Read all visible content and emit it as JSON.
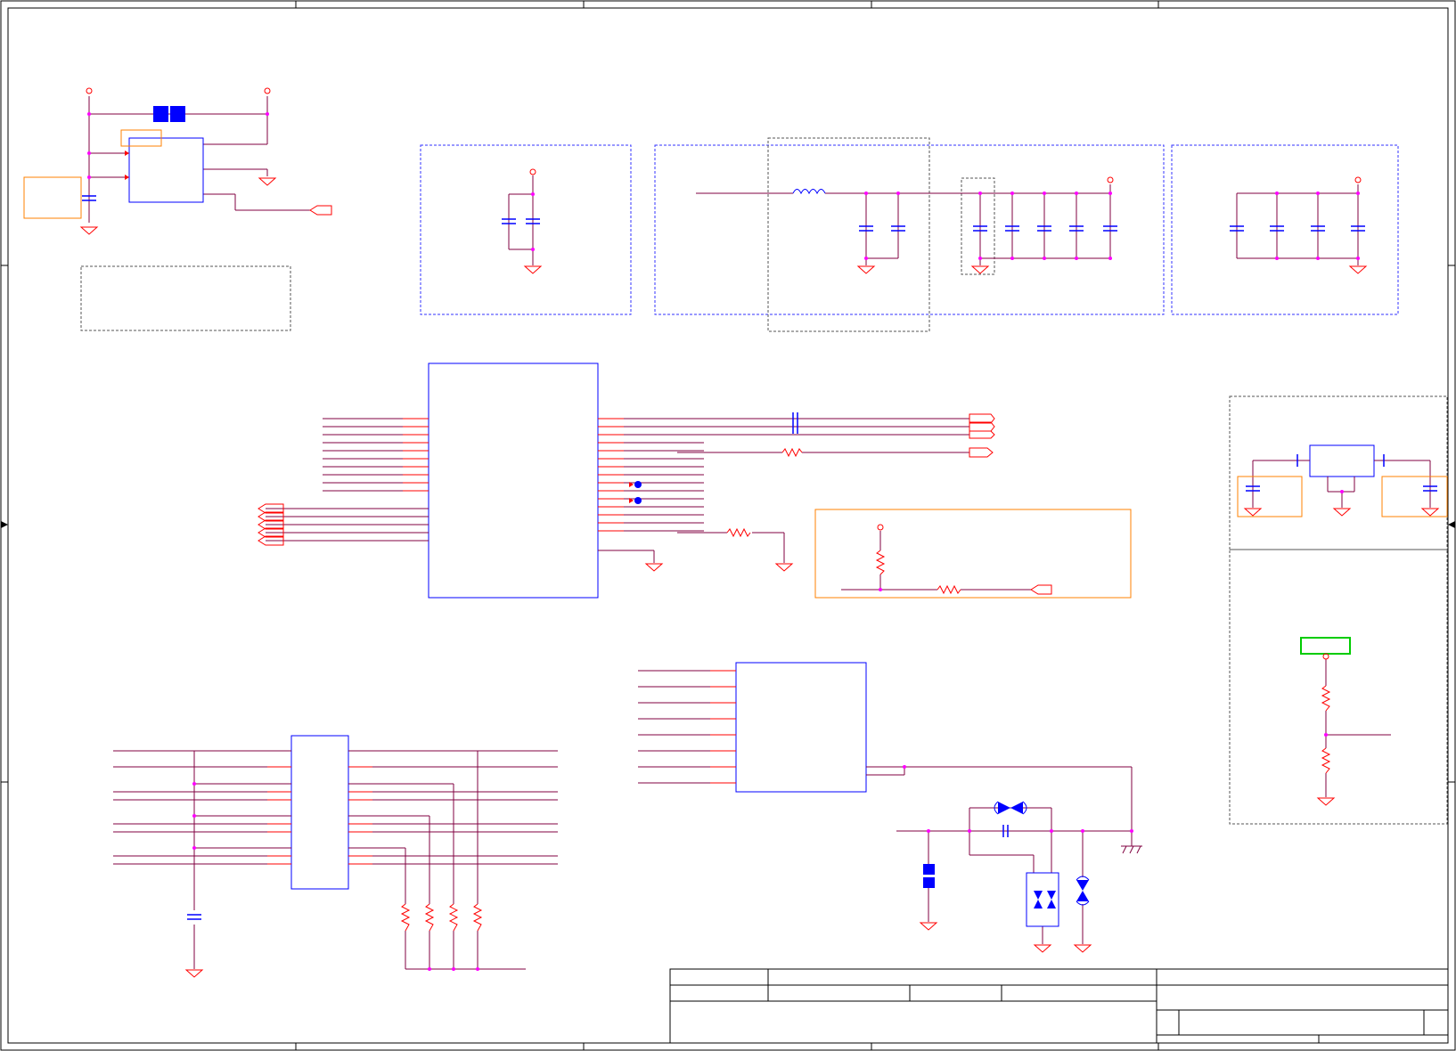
{
  "sheet": {
    "title": ""
  },
  "colors": {
    "background": "#ffffff",
    "frame": "#000000",
    "net_wire": "#800040",
    "signal_wire": "#ff0000",
    "component": "#0000ff",
    "junction": "#ff00ff",
    "power_port": "#ff0000",
    "highlight_box_orange": "#ff8000",
    "highlight_box_green": "#00cc00",
    "group_box_blue": "#3333ff",
    "group_box_gray": "#555555"
  }
}
